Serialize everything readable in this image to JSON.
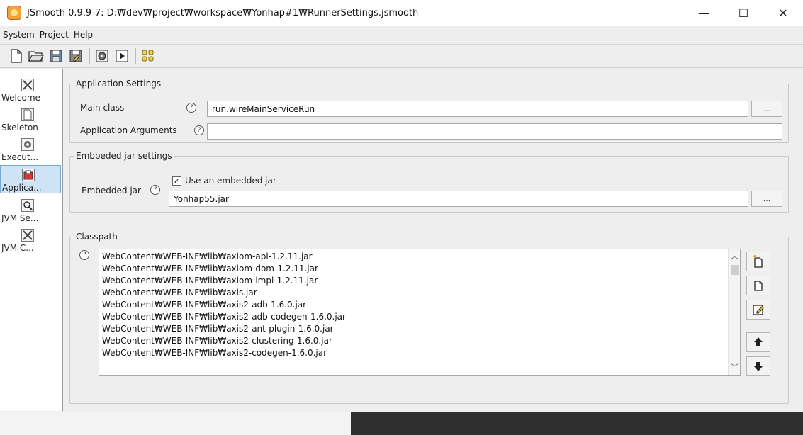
{
  "window": {
    "title": "JSmooth 0.9.9-7: D:₩dev₩project₩workspace₩Yonhap#1₩RunnerSettings.jsmooth",
    "controls": [
      "—",
      "☐",
      "✕"
    ]
  },
  "menu": [
    "System",
    "Project",
    "Help"
  ],
  "toolbar": {
    "buttons": [
      "new-file-icon",
      "open-folder-icon",
      "save-icon",
      "save-as-icon",
      "compile-icon",
      "run-icon",
      "wizard-icon"
    ]
  },
  "nav": [
    {
      "label": "Welcome",
      "icon": "welcome-icon"
    },
    {
      "label": "Skeleton",
      "icon": "skeleton-icon"
    },
    {
      "label": "Execut...",
      "icon": "executable-icon"
    },
    {
      "label": "Applica...",
      "icon": "application-icon",
      "selected": true
    },
    {
      "label": "JVM Se...",
      "icon": "jvm-selection-icon"
    },
    {
      "label": "JVM C...",
      "icon": "jvm-configuration-icon"
    }
  ],
  "app_settings": {
    "legend": "Application Settings",
    "main_class_label": "Main class",
    "main_class_value": "run.wireMainServiceRun",
    "args_label": "Application Arguments",
    "args_value": "",
    "browse_label": "..."
  },
  "jar_settings": {
    "legend": "Embbeded jar settings",
    "embedded_label": "Embedded jar",
    "use_embedded_label": "Use an embedded jar",
    "use_embedded_checked": true,
    "jar_value": "Yonhap55.jar",
    "browse_label": "..."
  },
  "classpath": {
    "legend": "Classpath",
    "items": [
      "WebContent₩WEB-INF₩lib₩axiom-api-1.2.11.jar",
      "WebContent₩WEB-INF₩lib₩axiom-dom-1.2.11.jar",
      "WebContent₩WEB-INF₩lib₩axiom-impl-1.2.11.jar",
      "WebContent₩WEB-INF₩lib₩axis.jar",
      "WebContent₩WEB-INF₩lib₩axis2-adb-1.6.0.jar",
      "WebContent₩WEB-INF₩lib₩axis2-adb-codegen-1.6.0.jar",
      "WebContent₩WEB-INF₩lib₩axis2-ant-plugin-1.6.0.jar",
      "WebContent₩WEB-INF₩lib₩axis2-clustering-1.6.0.jar",
      "WebContent₩WEB-INF₩lib₩axis2-codegen-1.6.0.jar"
    ]
  },
  "help_glyph": "?"
}
